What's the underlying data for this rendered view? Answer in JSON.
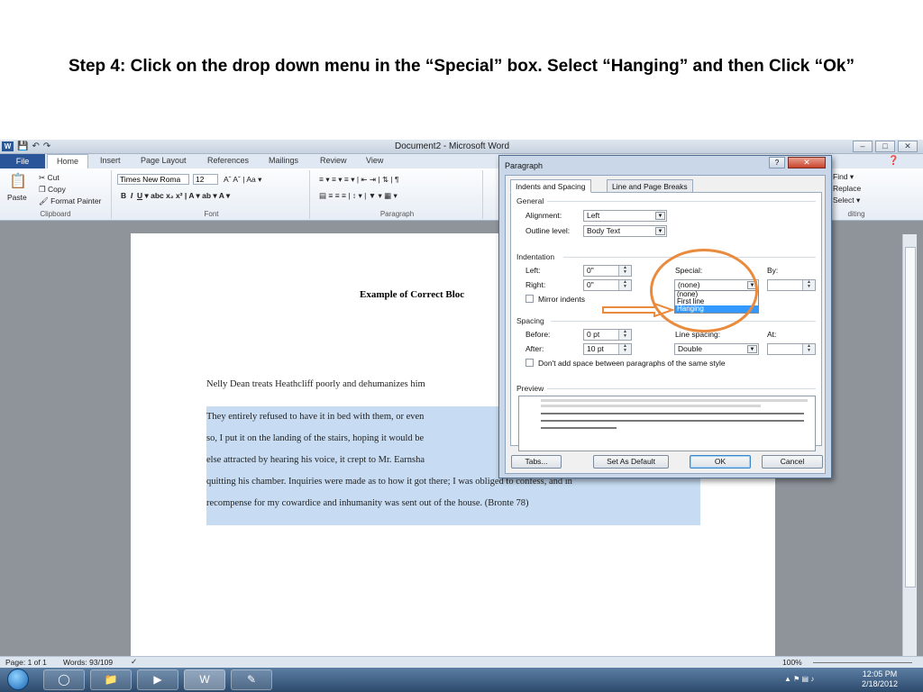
{
  "slide": {
    "title": "Step 4: Click on the drop down menu in the “Special” box. Select “Hanging” and then Click “Ok”"
  },
  "window": {
    "title": "Document2 - Microsoft Word"
  },
  "ribbon": {
    "tabs": [
      "File",
      "Home",
      "Insert",
      "Page Layout",
      "References",
      "Mailings",
      "Review",
      "View"
    ],
    "clipboard": {
      "cut": "Cut",
      "copy": "Copy",
      "paste": "Paste",
      "format_painter": "Format Painter",
      "label": "Clipboard"
    },
    "font": {
      "name": "Times New Roma",
      "size": "12",
      "label": "Font"
    },
    "paragraph_label": "Paragraph",
    "editing": {
      "find": "Find",
      "replace": "Replace",
      "select": "Select",
      "label": "diting"
    }
  },
  "document": {
    "heading": "Example of Correct Bloc",
    "intro": "Nelly Dean treats Heathcliff poorly and dehumanizes him",
    "quote_lines": [
      "They entirely refused to have it in bed with them, or even",
      "so, I put it on the landing of the stairs, hoping it would be",
      "else attracted by hearing his voice, it crept to Mr. Earnsha",
      "quitting his chamber. Inquiries were made as to how it got there; I was obliged to confess, and in",
      "recompense for my cowardice and inhumanity was sent out of the house. (Bronte 78)"
    ]
  },
  "dialog": {
    "title": "Paragraph",
    "help": "?",
    "tabs": [
      "Indents and Spacing",
      "Line and Page Breaks"
    ],
    "general": {
      "section": "General",
      "alignment_label": "Alignment:",
      "alignment_value": "Left",
      "outline_label": "Outline level:",
      "outline_value": "Body Text"
    },
    "indentation": {
      "section": "Indentation",
      "left_label": "Left:",
      "left_value": "0\"",
      "right_label": "Right:",
      "right_value": "0\"",
      "special_label": "Special:",
      "special_value": "(none)",
      "by_label": "By:",
      "mirror_label": "Mirror indents",
      "special_options": [
        "(none)",
        "First line",
        "Hanging"
      ],
      "selected_option": "Hanging"
    },
    "spacing": {
      "section": "Spacing",
      "before_label": "Before:",
      "before_value": "0 pt",
      "after_label": "After:",
      "after_value": "10 pt",
      "line_label": "Line spacing:",
      "line_value": "Double",
      "at_label": "At:",
      "dont_add_label": "Don't add space between paragraphs of the same style"
    },
    "preview_label": "Preview",
    "buttons": {
      "tabs": "Tabs...",
      "set_default": "Set As Default",
      "ok": "OK",
      "cancel": "Cancel"
    }
  },
  "status": {
    "page": "Page: 1 of 1",
    "words": "Words: 93/109",
    "zoom": "100%"
  },
  "taskbar": {
    "time": "12:05 PM",
    "date": "2/18/2012"
  },
  "annotation": {
    "color": "#e98a3d"
  }
}
